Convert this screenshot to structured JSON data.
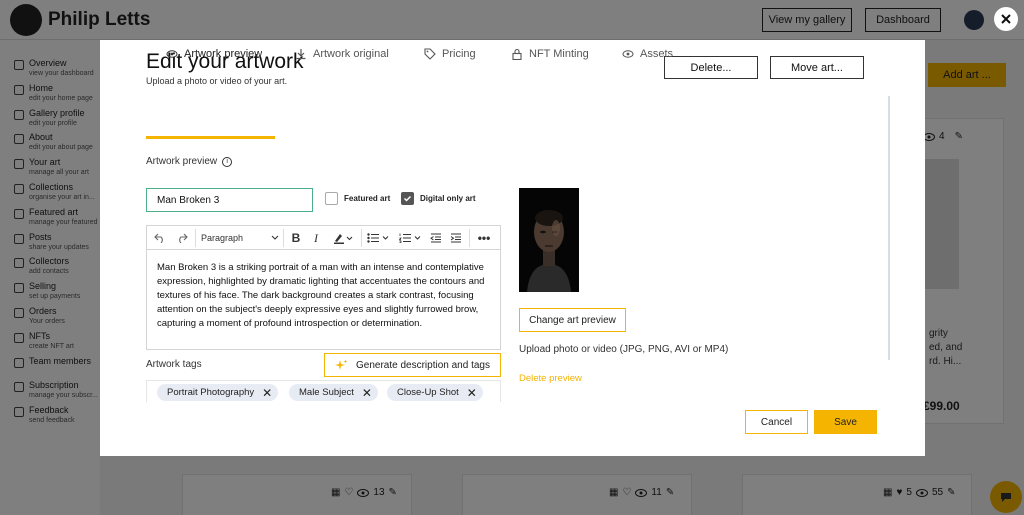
{
  "background": {
    "brand": "Philip Letts",
    "buttons": {
      "view_gallery": "View my gallery",
      "dashboard": "Dashboard",
      "add_art": "Add art ..."
    },
    "sidebar": [
      {
        "title": "Overview",
        "sub": "view your dashboard"
      },
      {
        "title": "Home",
        "sub": "edit your home page"
      },
      {
        "title": "Gallery profile",
        "sub": "edit your profile"
      },
      {
        "title": "About",
        "sub": "edit your about page"
      },
      {
        "title": "Your art",
        "sub": "manage all your art"
      },
      {
        "title": "Collections",
        "sub": "organise your art in..."
      },
      {
        "title": "Featured art",
        "sub": "manage your featured"
      },
      {
        "title": "Posts",
        "sub": "share your updates"
      },
      {
        "title": "Collectors",
        "sub": "add contacts"
      },
      {
        "title": "Selling",
        "sub": "set up payments"
      },
      {
        "title": "Orders",
        "sub": "Your orders"
      },
      {
        "title": "NFTs",
        "sub": "create NFT art"
      },
      {
        "title": "Team members",
        "sub": ""
      },
      {
        "title": "Subscription",
        "sub": "manage your subscr..."
      },
      {
        "title": "Feedback",
        "sub": "send feedback"
      }
    ],
    "card_text": [
      "grity",
      "ed, and",
      "rd. Hi..."
    ],
    "card_price": "£99.00",
    "card_counts": {
      "top_views": "4",
      "c1_views": "13",
      "c2_views": "11",
      "c3_likes": "5",
      "c3_views": "55"
    }
  },
  "modal": {
    "title": "Edit your artwork",
    "subtitle": "Upload a photo or video of your art.",
    "delete_label": "Delete...",
    "move_label": "Move art...",
    "tabs": [
      {
        "label": "Artwork preview",
        "icon": "eye-icon"
      },
      {
        "label": "Artwork original",
        "icon": "download-icon"
      },
      {
        "label": "Pricing",
        "icon": "tag-icon"
      },
      {
        "label": "NFT Minting",
        "icon": "lock-icon"
      },
      {
        "label": "Assets",
        "icon": "eye-icon"
      }
    ],
    "section_label": "Artwork preview",
    "name_value": "Man Broken 3",
    "featured_label": "Featured art",
    "featured_checked": false,
    "digital_label": "Digital only art",
    "digital_checked": true,
    "toolbar": {
      "paragraph": "Paragraph"
    },
    "description": "Man Broken 3 is a striking portrait of a man with an intense and contemplative expression, highlighted by dramatic lighting that accentuates the contours and textures of his face. The dark background creates a stark contrast, focusing attention on the subject's deeply expressive eyes and slightly furrowed brow, capturing a moment of profound introspection or determination.",
    "tags_label": "Artwork tags",
    "generate_label": "Generate description and tags",
    "tags": [
      "Portrait Photography",
      "Male Subject",
      "Close-Up Shot"
    ],
    "change_preview_label": "Change art preview",
    "upload_text": "Upload photo or video (JPG, PNG, AVI or MP4)",
    "delete_preview_label": "Delete preview",
    "cancel_label": "Cancel",
    "save_label": "Save"
  },
  "colors": {
    "accent": "#f5b400",
    "input_border": "#4caf8a",
    "tag_bg": "#e7ebf3"
  }
}
